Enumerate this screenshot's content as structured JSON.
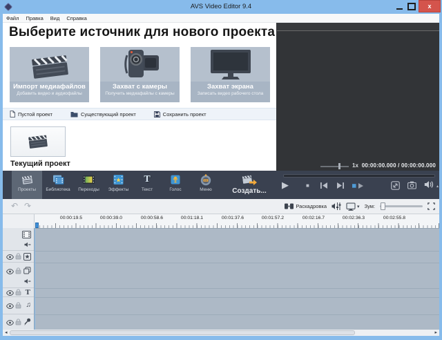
{
  "window": {
    "title": "AVS Video Editor 9.4",
    "close_glyph": "x"
  },
  "menu": {
    "items": [
      "Файл",
      "Правка",
      "Вид",
      "Справка"
    ]
  },
  "start": {
    "heading": "Выберите источник для нового проекта",
    "cards": [
      {
        "title": "Импорт медиафайлов",
        "subtitle": "Добавить видео и аудиофайлы"
      },
      {
        "title": "Захват с камеры",
        "subtitle": "Получить медиафайлы с камеры"
      },
      {
        "title": "Захват экрана",
        "subtitle": "Записать видео рабочего стола"
      }
    ],
    "actions": [
      {
        "label": "Пустой проект"
      },
      {
        "label": "Существующий проект"
      },
      {
        "label": "Сохранить проект"
      }
    ],
    "current_project": "Текущий проект"
  },
  "preview": {
    "speed": "1x",
    "timecode": "00:00:00.000 / 00:00:00.000"
  },
  "toolbar": {
    "items": [
      {
        "label": "Проекты",
        "selected": true
      },
      {
        "label": "Библиотека"
      },
      {
        "label": "Переходы"
      },
      {
        "label": "Эффекты"
      },
      {
        "label": "Текст"
      },
      {
        "label": "Голос"
      },
      {
        "label": "Меню"
      },
      {
        "label": "Создать..."
      }
    ]
  },
  "timeline": {
    "storyboard_label": "Раскадровка",
    "zoom_label": "Зум:",
    "ruler_labels": [
      "00:00:19.5",
      "00:00:39.0",
      "00:00:58.6",
      "00:01:18.1",
      "00:01:37.6",
      "00:01:57.2",
      "00:02:16.7",
      "00:02:36.3",
      "00:02:55.8"
    ]
  },
  "icons": {
    "undo": "↶",
    "redo": "↷",
    "play": "▶",
    "stop": "■",
    "note": "♫",
    "text": "T",
    "star": "★",
    "dropdown": "▾",
    "volume_caret": "▴",
    "scroll_left": "◂",
    "scroll_right": "▸"
  },
  "colors": {
    "titlebar_blue": "#87bbeb",
    "close_red": "#d4544c",
    "toolbar_bg": "#3a4150",
    "toolbar_selected": "#5d6775",
    "card_bg": "#b5c0cd",
    "card_caption_bg": "#a8b5c4",
    "preview_bg": "#323437",
    "track_bg": "#adb9c6",
    "accent_orange": "#f2a93b",
    "accent_blue": "#3f96d2",
    "playhead_blue": "#3f8fd8"
  }
}
